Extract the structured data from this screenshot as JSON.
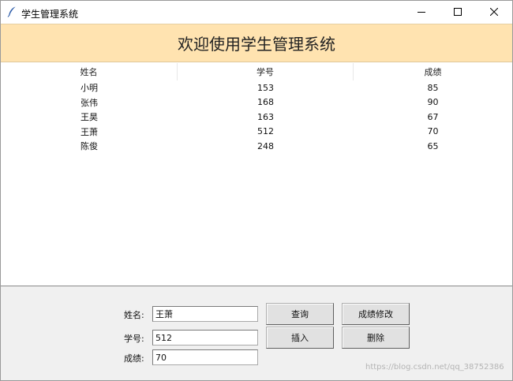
{
  "window": {
    "title": "学生管理系统",
    "icon": "feather-icon"
  },
  "banner": {
    "text": "欢迎使用学生管理系统",
    "background": "#ffe3b0"
  },
  "table": {
    "headers": [
      "姓名",
      "学号",
      "成绩"
    ],
    "rows": [
      [
        "小明",
        "153",
        "85"
      ],
      [
        "张伟",
        "168",
        "90"
      ],
      [
        "王昊",
        "163",
        "67"
      ],
      [
        "王萧",
        "512",
        "70"
      ],
      [
        "陈俊",
        "248",
        "65"
      ]
    ]
  },
  "form": {
    "name_label": "姓名:",
    "name_value": "王萧",
    "id_label": "学号:",
    "id_value": "512",
    "score_label": "成绩:",
    "score_value": "70",
    "query_button": "查询",
    "modify_button": "成绩修改",
    "insert_button": "插入",
    "delete_button": "删除"
  },
  "watermark": "https://blog.csdn.net/qq_38752386"
}
